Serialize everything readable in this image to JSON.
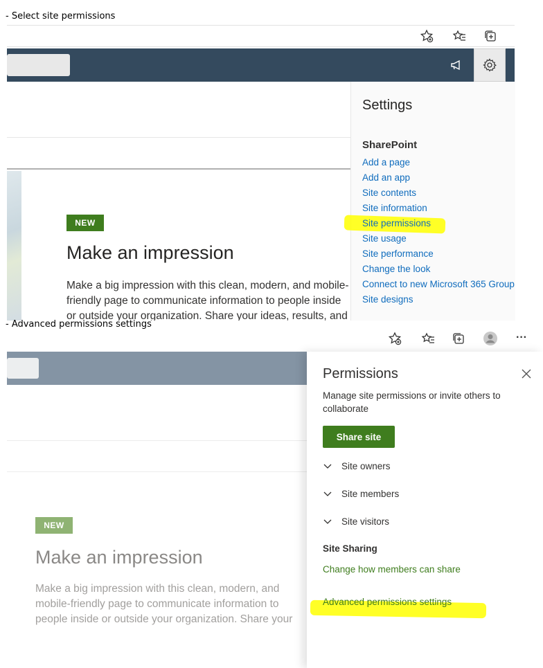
{
  "panel1": {
    "caption": "- Select site permissions",
    "toolbar_icons": [
      "favorite-add-icon",
      "favorites-icon",
      "collections-icon"
    ],
    "suite_icons": [
      "megaphone-icon",
      "gear-icon"
    ],
    "hero": {
      "badge": "NEW",
      "title": "Make an impression",
      "body": "Make a big impression with this clean, modern, and mobile-friendly page to communicate information to people inside or outside your organization. Share your ideas, results, and more in this visually compelling format."
    },
    "settings": {
      "title": "Settings",
      "section": "SharePoint",
      "links": [
        "Add a page",
        "Add an app",
        "Site contents",
        "Site information",
        "Site permissions",
        "Site usage",
        "Site performance",
        "Change the look",
        "Connect to new Microsoft 365 Group",
        "Site designs"
      ]
    }
  },
  "panel2": {
    "caption": "- Advanced permissions settings",
    "toolbar_icons": [
      "favorite-add-icon",
      "favorites-icon",
      "collections-icon",
      "profile-icon",
      "more-icon"
    ],
    "more_label": "···",
    "hero": {
      "badge": "NEW",
      "title": "Make an impression",
      "body": "Make a big impression with this clean, modern, and mobile-friendly page to communicate information to people inside or outside your organization. Share your ideas, results, and more in this visually compelling format."
    },
    "permissions": {
      "title": "Permissions",
      "description": "Manage site permissions or invite others to collaborate",
      "share_button": "Share site",
      "groups": [
        "Site owners",
        "Site members",
        "Site visitors"
      ],
      "sharing_heading": "Site Sharing",
      "change_link": "Change how members can share",
      "advanced_link": "Advanced permissions settings"
    }
  },
  "colors": {
    "suitebar": "#344a5e",
    "link_blue": "#0f6cbd",
    "brand_green": "#3f7d1e",
    "highlight": "#ffff00"
  }
}
